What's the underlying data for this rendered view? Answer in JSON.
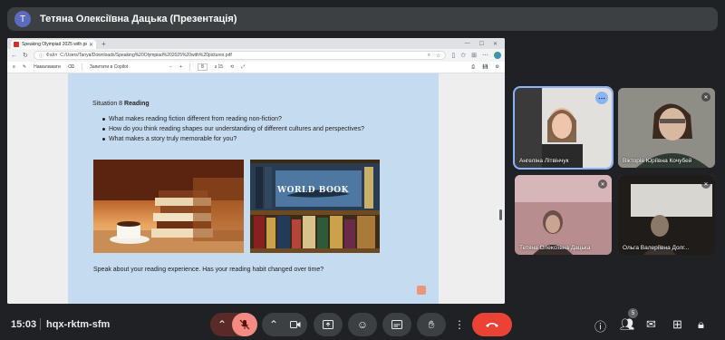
{
  "presenter": {
    "initial": "T",
    "title": "Тетяна Олексіївна Дацька (Презентація)"
  },
  "browser": {
    "tab_title": "Speaking Olympiad 2025 with pic",
    "url_prefix": "Файл",
    "url": "C:/Users/Tanya/Downloads/Speaking%20Olympiad%202025%20with%20pictures.pdf",
    "pdf_toolbar": {
      "draw_label": "Намалювати",
      "copilot_label": "Запитати в Copilot",
      "page_current": "8",
      "page_total": "з 15"
    }
  },
  "slide": {
    "title_prefix": "Situation 8",
    "title_bold": "Reading",
    "questions": [
      "What makes reading fiction different from reading non-fiction?",
      "How do you think reading shapes our understanding of different cultures and perspectives?",
      "What makes a story truly memorable for you?"
    ],
    "image_shelf_text": "WORLD BOOK",
    "prompt": "Speak about your reading experience. Has your reading habit changed over time?"
  },
  "participants": [
    {
      "name": "Ангеліна Літвінчук",
      "active": true
    },
    {
      "name": "Вікторія Юріївна Кочубей",
      "muted": true
    },
    {
      "name": "Тетяна Олексіївна Дацька",
      "muted": true
    },
    {
      "name": "Ольга Валеріївна Долг...",
      "muted": true
    }
  ],
  "meeting": {
    "time": "15:03",
    "code": "hqx-rktm-sfm",
    "participant_count": "5"
  },
  "colors": {
    "accent": "#8ab4f8",
    "end_call": "#ea4335",
    "mic_off": "#f28b82",
    "background": "#202124"
  }
}
